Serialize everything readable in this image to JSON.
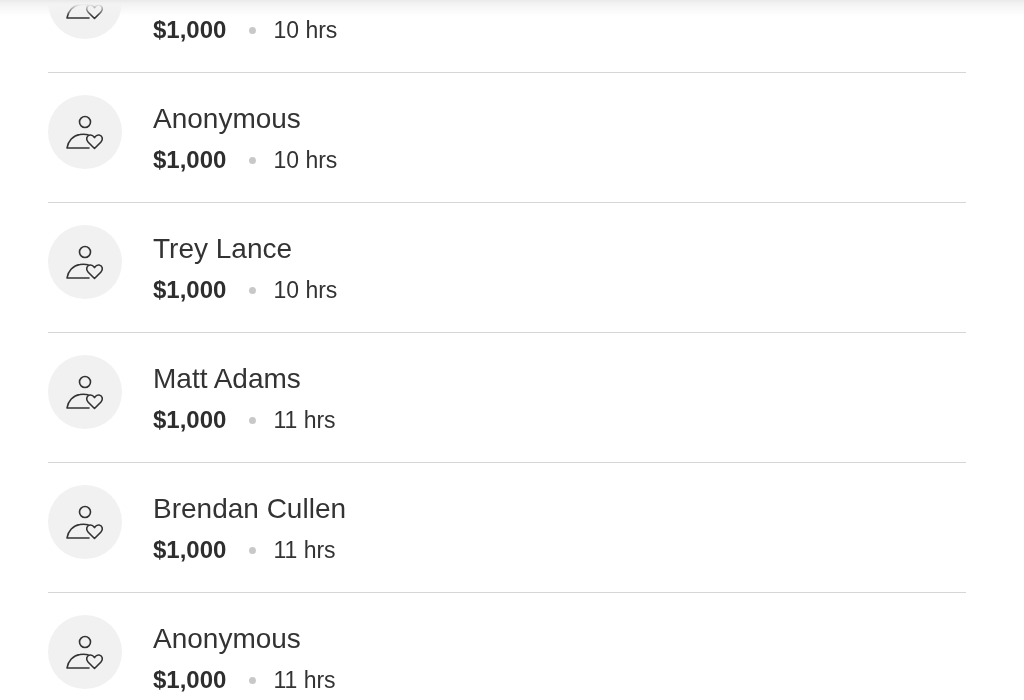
{
  "donations": [
    {
      "amount": "$1,000",
      "time": "10 hrs"
    },
    {
      "name": "Anonymous",
      "amount": "$1,000",
      "time": "10 hrs"
    },
    {
      "name": "Trey Lance",
      "amount": "$1,000",
      "time": "10 hrs"
    },
    {
      "name": "Matt Adams",
      "amount": "$1,000",
      "time": "11 hrs"
    },
    {
      "name": "Brendan Cullen",
      "amount": "$1,000",
      "time": "11 hrs"
    },
    {
      "name": "Anonymous",
      "amount": "$1,000",
      "time": "11 hrs"
    }
  ]
}
